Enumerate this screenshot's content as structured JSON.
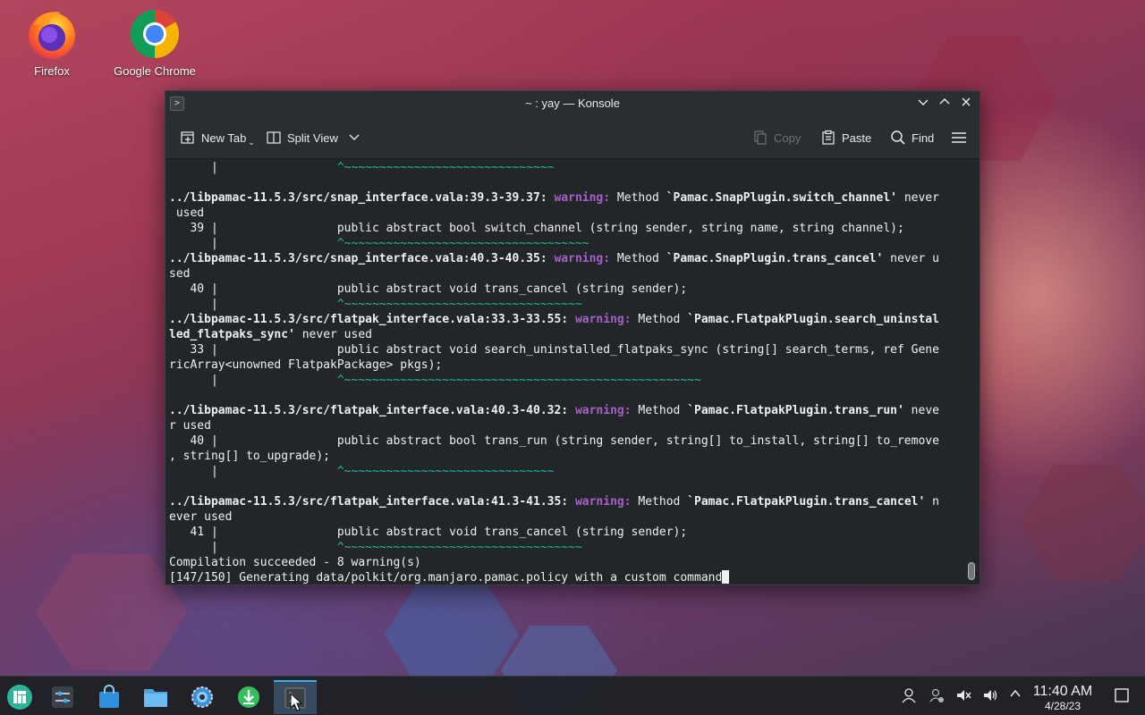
{
  "desktop": {
    "icons": [
      {
        "label": "Firefox"
      },
      {
        "label": "Google Chrome"
      }
    ]
  },
  "window": {
    "title": "~ : yay — Konsole",
    "toolbar": {
      "new_tab": "New Tab",
      "split_view": "Split View",
      "copy": "Copy",
      "paste": "Paste",
      "find": "Find"
    },
    "terminal": {
      "lines": [
        {
          "segments": [
            {
              "t": "      |                 "
            },
            {
              "t": "^~~~~~~~~~~~~~~~~~~~~~~~~~~~~~~",
              "c": "g"
            }
          ]
        },
        {
          "segments": [
            {
              "t": ""
            }
          ]
        },
        {
          "segments": [
            {
              "t": "../libpamac-11.5.3/src/snap_interface.vala:39.3-39.37:",
              "c": "b"
            },
            {
              "t": " "
            },
            {
              "t": "warning:",
              "c": "w"
            },
            {
              "t": " Method "
            },
            {
              "t": "`Pamac.SnapPlugin.switch_channel'",
              "c": "b"
            },
            {
              "t": " never"
            }
          ]
        },
        {
          "segments": [
            {
              "t": " used"
            }
          ]
        },
        {
          "segments": [
            {
              "t": "   39 |                 public abstract bool switch_channel (string sender, string name, string channel);"
            }
          ]
        },
        {
          "segments": [
            {
              "t": "      |                 "
            },
            {
              "t": "^~~~~~~~~~~~~~~~~~~~~~~~~~~~~~~~~~~~",
              "c": "g"
            }
          ]
        },
        {
          "segments": [
            {
              "t": "../libpamac-11.5.3/src/snap_interface.vala:40.3-40.35:",
              "c": "b"
            },
            {
              "t": " "
            },
            {
              "t": "warning:",
              "c": "w"
            },
            {
              "t": " Method "
            },
            {
              "t": "`Pamac.SnapPlugin.trans_cancel'",
              "c": "b"
            },
            {
              "t": " never u"
            }
          ]
        },
        {
          "segments": [
            {
              "t": "sed"
            }
          ]
        },
        {
          "segments": [
            {
              "t": "   40 |                 public abstract void trans_cancel (string sender);"
            }
          ]
        },
        {
          "segments": [
            {
              "t": "      |                 "
            },
            {
              "t": "^~~~~~~~~~~~~~~~~~~~~~~~~~~~~~~~~~~",
              "c": "g"
            }
          ]
        },
        {
          "segments": [
            {
              "t": "../libpamac-11.5.3/src/flatpak_interface.vala:33.3-33.55:",
              "c": "b"
            },
            {
              "t": " "
            },
            {
              "t": "warning:",
              "c": "w"
            },
            {
              "t": " Method "
            },
            {
              "t": "`Pamac.FlatpakPlugin.search_uninstal",
              "c": "b"
            }
          ]
        },
        {
          "segments": [
            {
              "t": "led_flatpaks_sync'",
              "c": "b"
            },
            {
              "t": " never used"
            }
          ]
        },
        {
          "segments": [
            {
              "t": "   33 |                 public abstract void search_uninstalled_flatpaks_sync (string[] search_terms, ref Gene"
            }
          ]
        },
        {
          "segments": [
            {
              "t": "ricArray<unowned FlatpakPackage> pkgs);"
            }
          ]
        },
        {
          "segments": [
            {
              "t": "      |                 "
            },
            {
              "t": "^~~~~~~~~~~~~~~~~~~~~~~~~~~~~~~~~~~~~~~~~~~~~~~~~~~~",
              "c": "g"
            }
          ]
        },
        {
          "segments": [
            {
              "t": ""
            }
          ]
        },
        {
          "segments": [
            {
              "t": "../libpamac-11.5.3/src/flatpak_interface.vala:40.3-40.32:",
              "c": "b"
            },
            {
              "t": " "
            },
            {
              "t": "warning:",
              "c": "w"
            },
            {
              "t": " Method "
            },
            {
              "t": "`Pamac.FlatpakPlugin.trans_run'",
              "c": "b"
            },
            {
              "t": " neve"
            }
          ]
        },
        {
          "segments": [
            {
              "t": "r used"
            }
          ]
        },
        {
          "segments": [
            {
              "t": "   40 |                 public abstract bool trans_run (string sender, string[] to_install, string[] to_remove"
            }
          ]
        },
        {
          "segments": [
            {
              "t": ", string[] to_upgrade);"
            }
          ]
        },
        {
          "segments": [
            {
              "t": "      |                 "
            },
            {
              "t": "^~~~~~~~~~~~~~~~~~~~~~~~~~~~~~~",
              "c": "g"
            }
          ]
        },
        {
          "segments": [
            {
              "t": ""
            }
          ]
        },
        {
          "segments": [
            {
              "t": "../libpamac-11.5.3/src/flatpak_interface.vala:41.3-41.35:",
              "c": "b"
            },
            {
              "t": " "
            },
            {
              "t": "warning:",
              "c": "w"
            },
            {
              "t": " Method "
            },
            {
              "t": "`Pamac.FlatpakPlugin.trans_cancel'",
              "c": "b"
            },
            {
              "t": " n"
            }
          ]
        },
        {
          "segments": [
            {
              "t": "ever used"
            }
          ]
        },
        {
          "segments": [
            {
              "t": "   41 |                 public abstract void trans_cancel (string sender);"
            }
          ]
        },
        {
          "segments": [
            {
              "t": "      |                 "
            },
            {
              "t": "^~~~~~~~~~~~~~~~~~~~~~~~~~~~~~~~~~~",
              "c": "g"
            }
          ]
        },
        {
          "segments": [
            {
              "t": "Compilation succeeded - 8 warning(s)"
            }
          ]
        },
        {
          "segments": [
            {
              "t": "[147/150] Generating data/polkit/org.manjaro.pamac.policy with a custom command"
            }
          ],
          "cursor": true
        }
      ]
    }
  },
  "taskbar": {
    "clock": {
      "time": "11:40 AM",
      "date": "4/28/23"
    }
  },
  "colors": {
    "warning": "#a561c9",
    "caret": "#1abc9c",
    "accent": "#3daee9"
  }
}
